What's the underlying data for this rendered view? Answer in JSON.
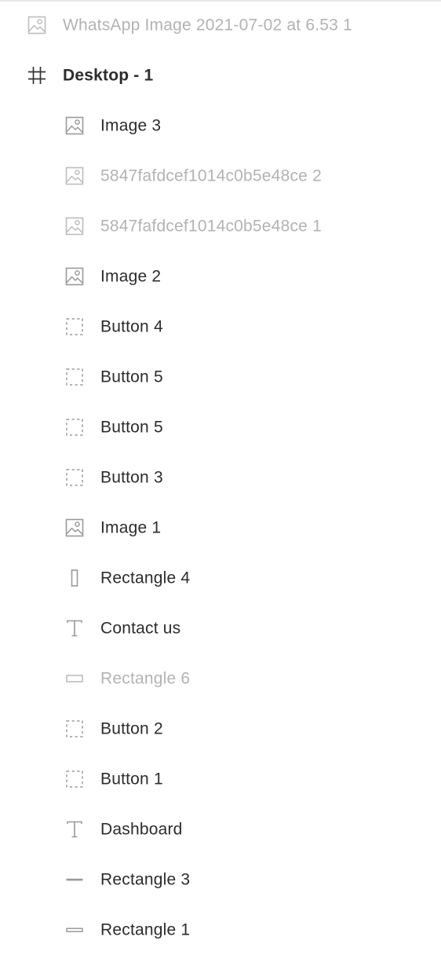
{
  "colors": {
    "text": "#2c2c2c",
    "muted_text": "#b3b3b3",
    "icon": "#9a9a9a",
    "icon_muted": "#bdbdbd"
  },
  "layers": [
    {
      "label": "WhatsApp Image 2021-07-02 at 6.53 1",
      "icon": "image-icon",
      "level": 0,
      "muted": true,
      "bold": false
    },
    {
      "label": "Desktop - 1",
      "icon": "frame-icon",
      "level": 0,
      "muted": false,
      "bold": true
    },
    {
      "label": "Image 3",
      "icon": "image-icon",
      "level": 1,
      "muted": false,
      "bold": false
    },
    {
      "label": "5847fafdcef1014c0b5e48ce 2",
      "icon": "image-icon",
      "level": 1,
      "muted": true,
      "bold": false
    },
    {
      "label": "5847fafdcef1014c0b5e48ce 1",
      "icon": "image-icon",
      "level": 1,
      "muted": true,
      "bold": false
    },
    {
      "label": "Image 2",
      "icon": "image-icon",
      "level": 1,
      "muted": false,
      "bold": false
    },
    {
      "label": "Button 4",
      "icon": "group-icon",
      "level": 1,
      "muted": false,
      "bold": false
    },
    {
      "label": "Button 5",
      "icon": "group-icon",
      "level": 1,
      "muted": false,
      "bold": false
    },
    {
      "label": "Button 5",
      "icon": "group-icon",
      "level": 1,
      "muted": false,
      "bold": false
    },
    {
      "label": "Button 3",
      "icon": "group-icon",
      "level": 1,
      "muted": false,
      "bold": false
    },
    {
      "label": "Image 1",
      "icon": "image-icon",
      "level": 1,
      "muted": false,
      "bold": false
    },
    {
      "label": "Rectangle 4",
      "icon": "tall-rectangle-icon",
      "level": 1,
      "muted": false,
      "bold": false
    },
    {
      "label": "Contact us",
      "icon": "text-icon",
      "level": 1,
      "muted": false,
      "bold": false
    },
    {
      "label": "Rectangle 6",
      "icon": "wide-rectangle-icon",
      "level": 1,
      "muted": true,
      "bold": false
    },
    {
      "label": "Button 2",
      "icon": "group-icon",
      "level": 1,
      "muted": false,
      "bold": false
    },
    {
      "label": "Button 1",
      "icon": "group-icon",
      "level": 1,
      "muted": false,
      "bold": false
    },
    {
      "label": "Dashboard",
      "icon": "text-icon",
      "level": 1,
      "muted": false,
      "bold": false
    },
    {
      "label": "Rectangle 3",
      "icon": "line-rectangle-icon",
      "level": 1,
      "muted": false,
      "bold": false
    },
    {
      "label": "Rectangle 1",
      "icon": "flat-rectangle-icon",
      "level": 1,
      "muted": false,
      "bold": false
    }
  ]
}
